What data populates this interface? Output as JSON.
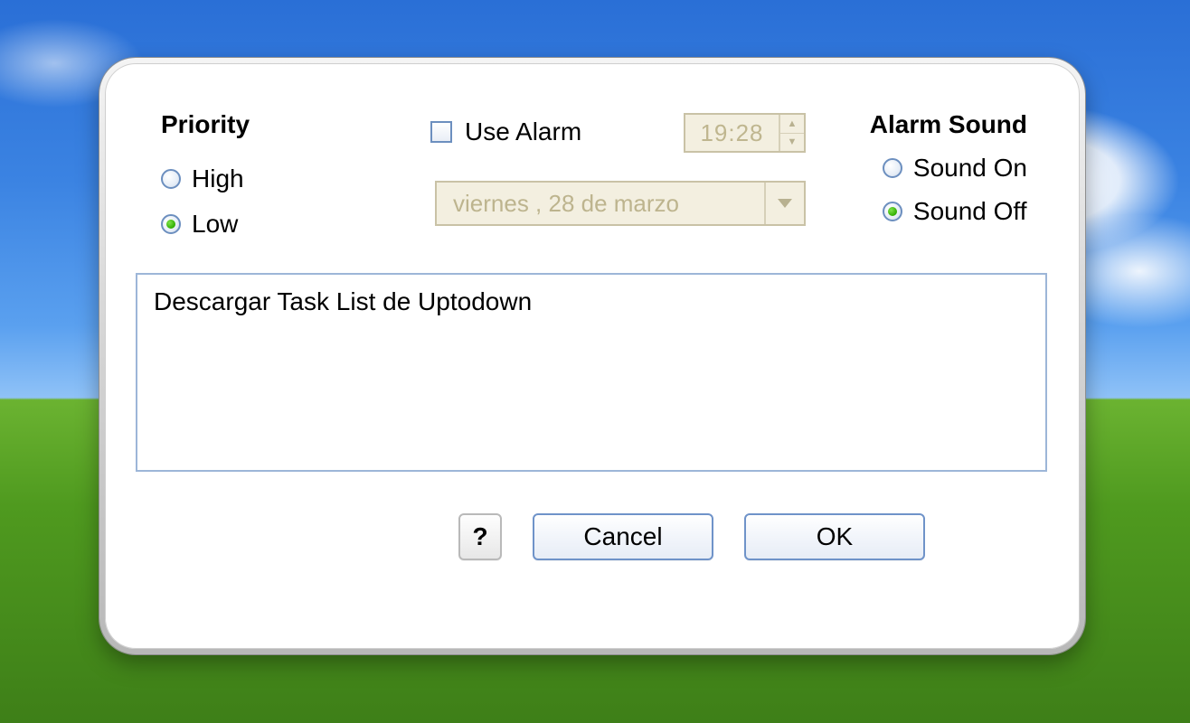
{
  "priority": {
    "heading": "Priority",
    "high_label": "High",
    "low_label": "Low",
    "selected": "low"
  },
  "alarm": {
    "use_alarm_label": "Use Alarm",
    "use_alarm_checked": false,
    "time_value": "19:28",
    "date_value": "viernes , 28 de   marzo"
  },
  "sound": {
    "heading": "Alarm Sound",
    "on_label": "Sound On",
    "off_label": "Sound Off",
    "selected": "off"
  },
  "task": {
    "value": "Descargar Task List de Uptodown"
  },
  "buttons": {
    "help": "?",
    "cancel": "Cancel",
    "ok": "OK"
  }
}
